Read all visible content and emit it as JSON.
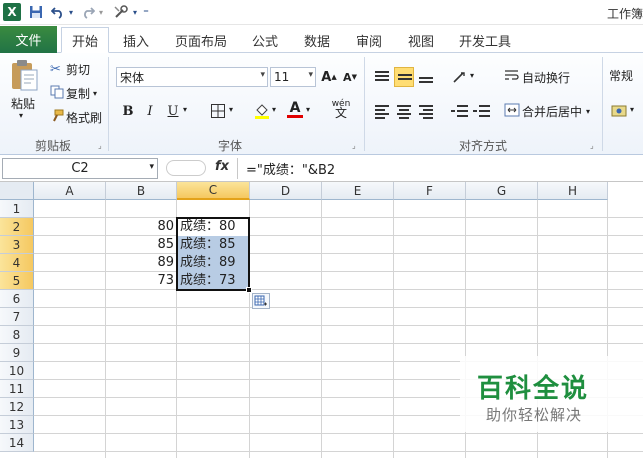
{
  "window": {
    "title": "工作簿"
  },
  "qat": {
    "save_icon": "save-icon",
    "undo_icon": "undo-icon",
    "redo_icon": "redo-icon"
  },
  "tabs": [
    {
      "label": "文件"
    },
    {
      "label": "开始"
    },
    {
      "label": "插入"
    },
    {
      "label": "页面布局"
    },
    {
      "label": "公式"
    },
    {
      "label": "数据"
    },
    {
      "label": "审阅"
    },
    {
      "label": "视图"
    },
    {
      "label": "开发工具"
    }
  ],
  "ribbon": {
    "clipboard": {
      "paste": "粘贴",
      "cut": "剪切",
      "copy": "复制",
      "format_painter": "格式刷",
      "label": "剪贴板"
    },
    "font": {
      "name": "宋体",
      "size": "11",
      "bold": "B",
      "italic": "I",
      "underline": "U",
      "grow": "A",
      "shrink": "A",
      "wen": "wén",
      "label": "字体"
    },
    "alignment": {
      "wrap": "自动换行",
      "merge": "合并后居中",
      "label": "对齐方式"
    },
    "number": {
      "format": "常规"
    }
  },
  "formula_bar": {
    "name_box": "C2",
    "fx": "fx",
    "formula": "=\"成绩：\"&B2"
  },
  "grid": {
    "columns": [
      "A",
      "B",
      "C",
      "D",
      "E",
      "F",
      "G",
      "H"
    ],
    "rows": [
      "1",
      "2",
      "3",
      "4",
      "5",
      "6",
      "7",
      "8",
      "9",
      "10",
      "11",
      "12",
      "13",
      "14"
    ],
    "b_values": [
      "80",
      "85",
      "89",
      "73"
    ],
    "c_values": [
      "成绩：80",
      "成绩：85",
      "成绩：89",
      "成绩：73"
    ]
  },
  "watermark": {
    "title": "百科全说",
    "subtitle": "助你轻松解决"
  },
  "colors": {
    "file_tab": "#217346",
    "selection": "#b8cce4",
    "header_selected": "#f5c860"
  }
}
